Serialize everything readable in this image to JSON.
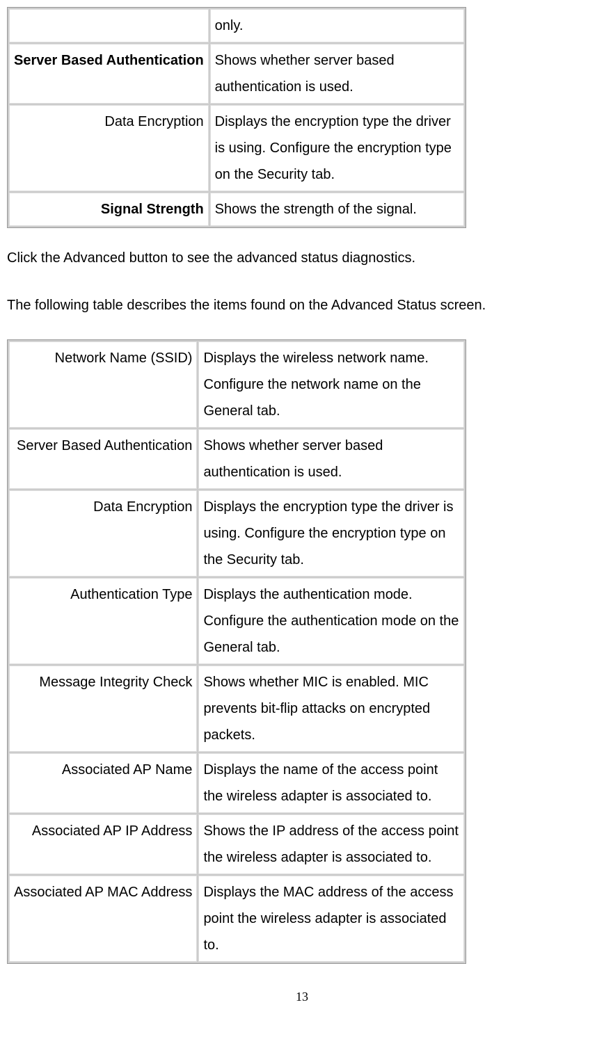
{
  "table1": {
    "rows": [
      {
        "label": "",
        "labelBold": false,
        "desc": "only."
      },
      {
        "label": "Server Based Authentication",
        "labelBold": true,
        "desc": "Shows whether server based authentication is used."
      },
      {
        "label": "Data Encryption",
        "labelBold": false,
        "desc": "Displays the encryption type the driver is using.    Configure the encryption type on the Security tab."
      },
      {
        "label": "Signal Strength",
        "labelBold": true,
        "desc": "Shows the strength of the signal."
      }
    ]
  },
  "paragraph1": "Click the Advanced button to see the advanced status diagnostics.",
  "paragraph2": "The following table describes the items found on the Advanced Status screen.",
  "table2": {
    "rows": [
      {
        "label": "Network Name (SSID)",
        "desc": "Displays the wireless network name.   Configure the network name on the General tab."
      },
      {
        "label": "Server Based Authentication",
        "desc": "Shows whether server based authentication is used."
      },
      {
        "label": "Data Encryption",
        "desc": "Displays the encryption type the driver is using.    Configure the encryption type on the Security tab."
      },
      {
        "label": "Authentication Type",
        "desc": "Displays the authentication mode.   Configure the authentication mode on the General tab."
      },
      {
        "label": "Message Integrity Check",
        "desc": "Shows whether MIC is enabled. MIC prevents bit-flip attacks on encrypted packets."
      },
      {
        "label": "Associated AP Name",
        "desc": "Displays the name of the access point the wireless adapter is associated to."
      },
      {
        "label": "Associated AP IP Address",
        "desc": "Shows the IP address of the access point the wireless adapter is associated to."
      },
      {
        "label": "Associated AP MAC Address",
        "desc": "Displays the MAC address of the access point the wireless adapter is associated to."
      }
    ]
  },
  "pageNumber": "13"
}
